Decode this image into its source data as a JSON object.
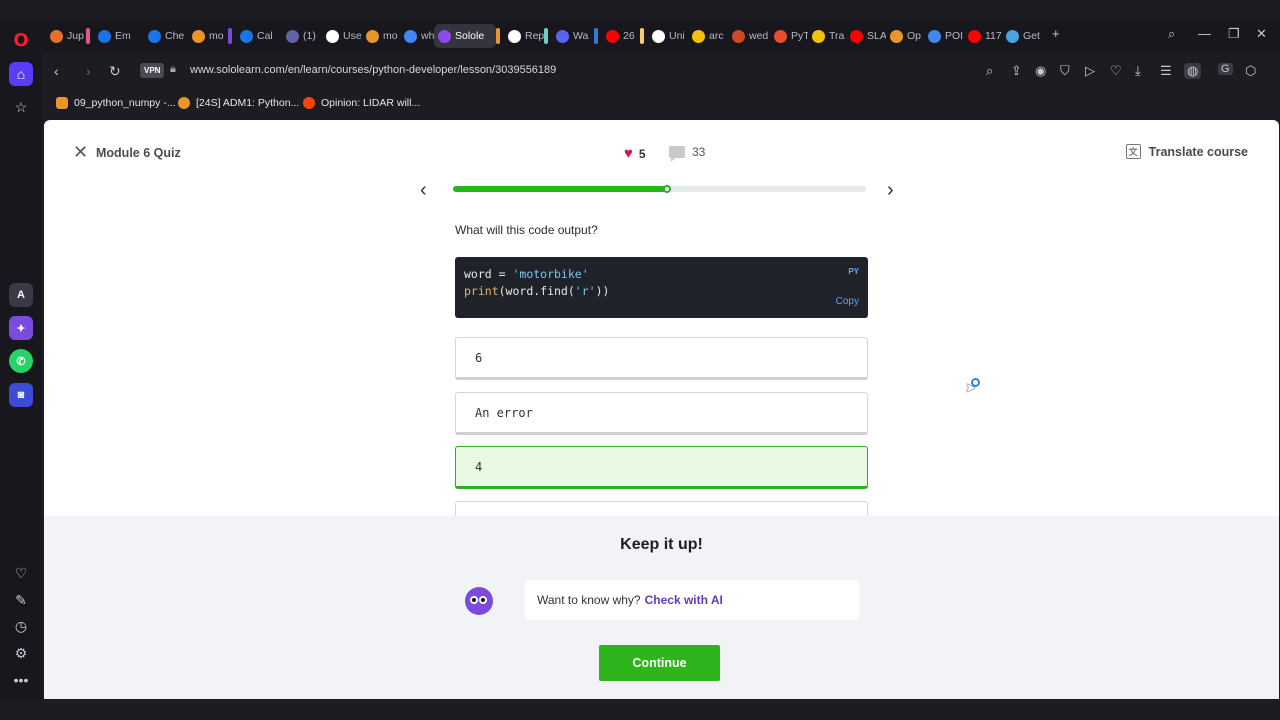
{
  "browser": {
    "tabs": [
      {
        "label": "Jup",
        "color": "#e8702a"
      },
      {
        "label": "Em",
        "color": "#1a73e8"
      },
      {
        "label": "Che",
        "color": "#1a73e8"
      },
      {
        "label": "mo",
        "color": "#e8952a"
      },
      {
        "label": "Cal",
        "color": "#1a73e8"
      },
      {
        "label": "(1)",
        "color": "#6264a7"
      },
      {
        "label": "Use",
        "color": "#ffffff"
      },
      {
        "label": "mo",
        "color": "#e8952a"
      },
      {
        "label": "wh",
        "color": "#4285f4"
      },
      {
        "label": "Solole",
        "color": "#8a4cf0"
      },
      {
        "label": "Rep",
        "color": "#ffffff"
      },
      {
        "label": "Wa",
        "color": "#5865f2"
      },
      {
        "label": "26",
        "color": "#ff0000"
      },
      {
        "label": "Uni",
        "color": "#ffffff"
      },
      {
        "label": "arc",
        "color": "#f4c20d"
      },
      {
        "label": "wed",
        "color": "#d24726"
      },
      {
        "label": "PyT",
        "color": "#ee4c2c"
      },
      {
        "label": "Tra",
        "color": "#f4c20d"
      },
      {
        "label": "SLA",
        "color": "#ff0000"
      },
      {
        "label": "Op",
        "color": "#e8952a"
      },
      {
        "label": "POI",
        "color": "#4285f4"
      },
      {
        "label": "117",
        "color": "#ff0000"
      },
      {
        "label": "Get",
        "color": "#4aa3df"
      }
    ],
    "vpn_label": "VPN",
    "url": "www.sololearn.com/en/learn/courses/python-developer/lesson/3039556189",
    "bookmarks": [
      {
        "label": "09_python_numpy -...",
        "color": "#e8952a"
      },
      {
        "label": "[24S] ADM1: Python...",
        "color": "#e8952a"
      },
      {
        "label": "Opinion: LIDAR will...",
        "color": "#ff4500"
      }
    ]
  },
  "quiz": {
    "title": "Module 6 Quiz",
    "hearts": "5",
    "comments": "33",
    "translate_label": "Translate course",
    "progress": 0.52,
    "question": "What will this code output?",
    "code": {
      "line1_a": "word = ",
      "line1_b": "'motorbike'",
      "line2_a": "print",
      "line2_b": "(word.find(",
      "line2_c": "'r'",
      "line2_d": "))",
      "lang": "PY",
      "copy_label": "Copy"
    },
    "options": [
      "6",
      "An error",
      "4"
    ]
  },
  "feedback": {
    "heading": "Keep it up!",
    "prompt": "Want to know why?",
    "link": "Check with AI",
    "continue_label": "Continue"
  }
}
